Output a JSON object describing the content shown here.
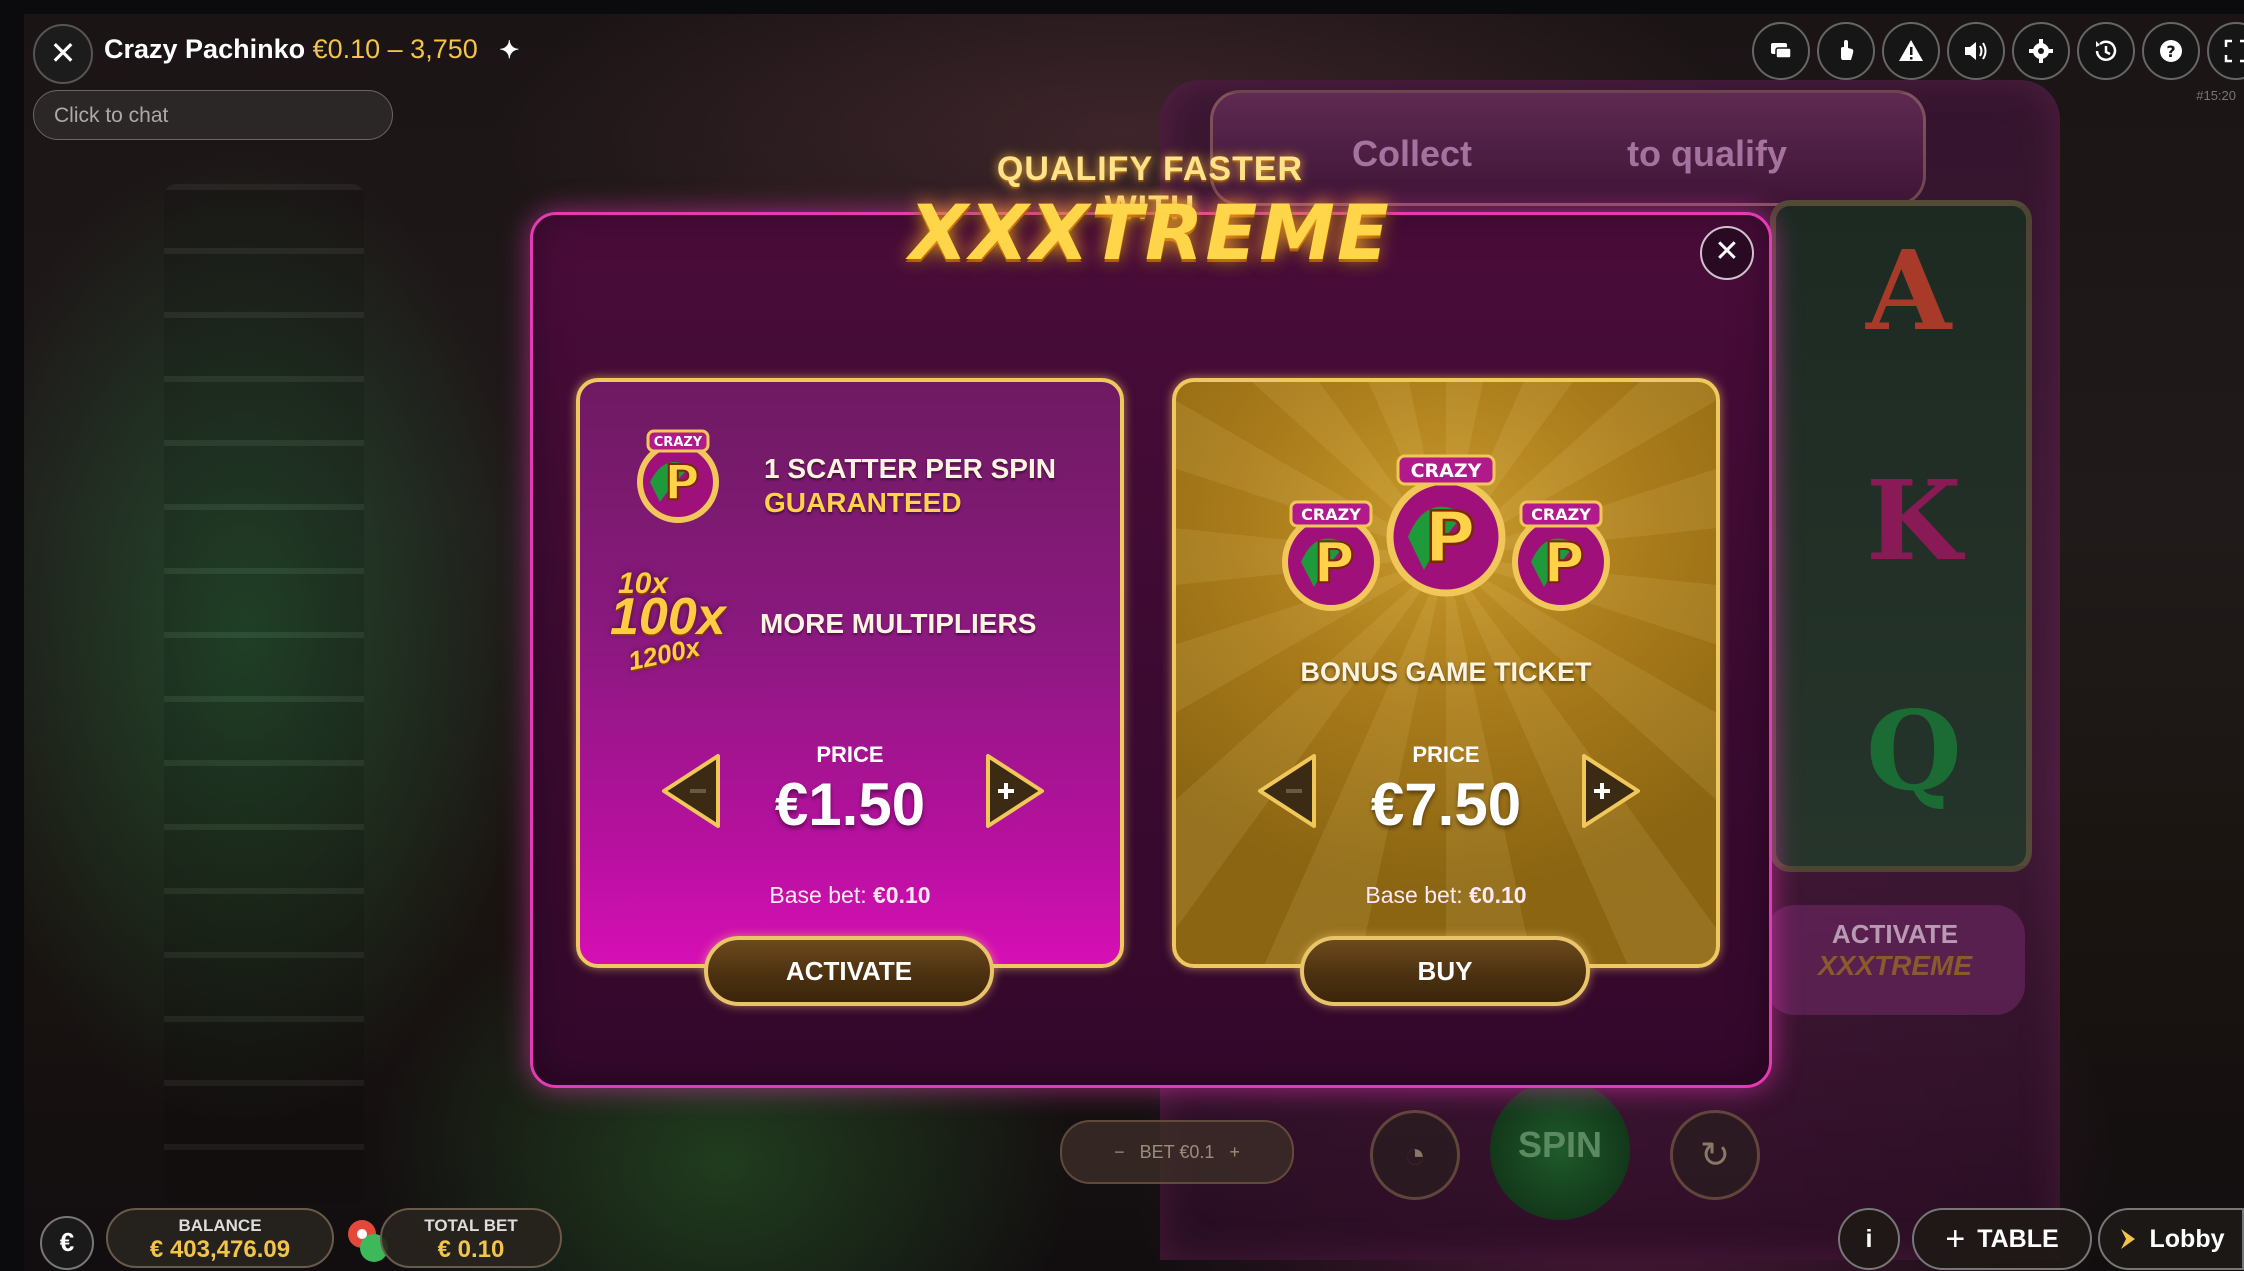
{
  "header": {
    "game_name": "Crazy Pachinko",
    "stake_range": "€0.10 – 3,750",
    "chat_placeholder": "Click to chat"
  },
  "toolbar": {
    "icons": [
      "chat-icon",
      "hand-icon",
      "warning-icon",
      "volume-icon",
      "settings-icon",
      "history-icon",
      "help-icon",
      "fullscreen-icon"
    ],
    "session_id": "#15:20"
  },
  "promo": {
    "heading": "QUALIFY FASTER WITH",
    "logo": "XXXTREME",
    "collect_text": "Collect",
    "qualify_text": "to qualify"
  },
  "offer_xxxtreme": {
    "feature1_line1": "1 SCATTER PER SPIN",
    "feature1_line2": "GUARANTEED",
    "mult1": "10x",
    "mult2": "100x",
    "mult3": "1200x",
    "feature2": "MORE MULTIPLIERS",
    "price_label": "PRICE",
    "price": "€1.50",
    "base_bet_label": "Base bet:",
    "base_bet": "€0.10",
    "button": "ACTIVATE"
  },
  "offer_ticket": {
    "title": "BONUS GAME TICKET",
    "coin_text": "CRAZY",
    "coin_letter": "P",
    "price_label": "PRICE",
    "price": "€7.50",
    "base_bet_label": "Base bet:",
    "base_bet": "€0.10",
    "button": "BUY"
  },
  "background": {
    "reel_letters": [
      "A",
      "K",
      "Q"
    ],
    "activate_label": "ACTIVATE",
    "activate_sub": "XXXTREME",
    "bet_label": "BET",
    "bet_value": "€0.1",
    "spin_label": "SPIN"
  },
  "footer": {
    "currency_symbol": "€",
    "balance_label": "BALANCE",
    "balance_value": "€ 403,476.09",
    "total_bet_label": "TOTAL BET",
    "total_bet_value": "€ 0.10",
    "info_label": "i",
    "table_label": "TABLE",
    "lobby_label": "Lobby"
  },
  "colors": {
    "accent_gold": "#f4c34a",
    "modal_border": "#e43bb5",
    "card_border": "#f0c860"
  }
}
